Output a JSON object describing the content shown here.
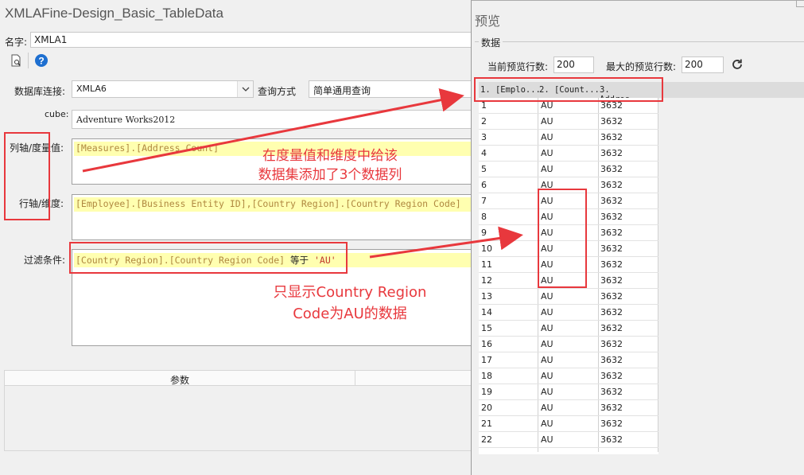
{
  "dialog": {
    "title": "XMLAFine-Design_Basic_TableData",
    "name_label": "名字:",
    "name_value": "XMLA1",
    "db_label": "数据库连接:",
    "db_value": "XMLA6",
    "query_mode_label": "查询方式",
    "query_mode_value": "简单通用查询",
    "cube_label": "cube:",
    "cube_value": "Adventure Works2012",
    "col_axis_label": "列轴/度量值:",
    "col_axis_value": "[Measures].[Address Count]",
    "row_axis_label": "行轴/维度:",
    "row_axis_value": "[Employee].[Business Entity ID],[Country Region].[Country Region Code]",
    "filter_label": "过滤条件:",
    "filter_field": "[Country Region].[Country Region Code]",
    "filter_op": "等于",
    "filter_value": "'AU'",
    "params_header": "参数"
  },
  "annotations": {
    "top_line1": "在度量值和维度中给该",
    "top_line2": "数据集添加了3个数据列",
    "bottom_line1": "只显示Country Region",
    "bottom_line2": "Code为AU的数据"
  },
  "preview": {
    "title": "预览",
    "group_label": "数据",
    "current_rows_label": "当前预览行数:",
    "current_rows_value": "200",
    "max_rows_label": "最大的预览行数:",
    "max_rows_value": "200",
    "columns": [
      "1. [Emplo...",
      "2. [Count...",
      "3. Addres..."
    ],
    "rows": [
      [
        "1",
        "AU",
        "3632"
      ],
      [
        "2",
        "AU",
        "3632"
      ],
      [
        "3",
        "AU",
        "3632"
      ],
      [
        "4",
        "AU",
        "3632"
      ],
      [
        "5",
        "AU",
        "3632"
      ],
      [
        "6",
        "AU",
        "3632"
      ],
      [
        "7",
        "AU",
        "3632"
      ],
      [
        "8",
        "AU",
        "3632"
      ],
      [
        "9",
        "AU",
        "3632"
      ],
      [
        "10",
        "AU",
        "3632"
      ],
      [
        "11",
        "AU",
        "3632"
      ],
      [
        "12",
        "AU",
        "3632"
      ],
      [
        "13",
        "AU",
        "3632"
      ],
      [
        "14",
        "AU",
        "3632"
      ],
      [
        "15",
        "AU",
        "3632"
      ],
      [
        "16",
        "AU",
        "3632"
      ],
      [
        "17",
        "AU",
        "3632"
      ],
      [
        "18",
        "AU",
        "3632"
      ],
      [
        "19",
        "AU",
        "3632"
      ],
      [
        "20",
        "AU",
        "3632"
      ],
      [
        "21",
        "AU",
        "3632"
      ],
      [
        "22",
        "AU",
        "3632"
      ]
    ]
  },
  "colors": {
    "annotation_red": "#e8383d",
    "highlight": "#ffffb0",
    "help_blue": "#1e6fd0"
  },
  "icons": [
    "preview-doc-icon",
    "help-icon",
    "dropdown-chevron-icon",
    "refresh-icon"
  ]
}
